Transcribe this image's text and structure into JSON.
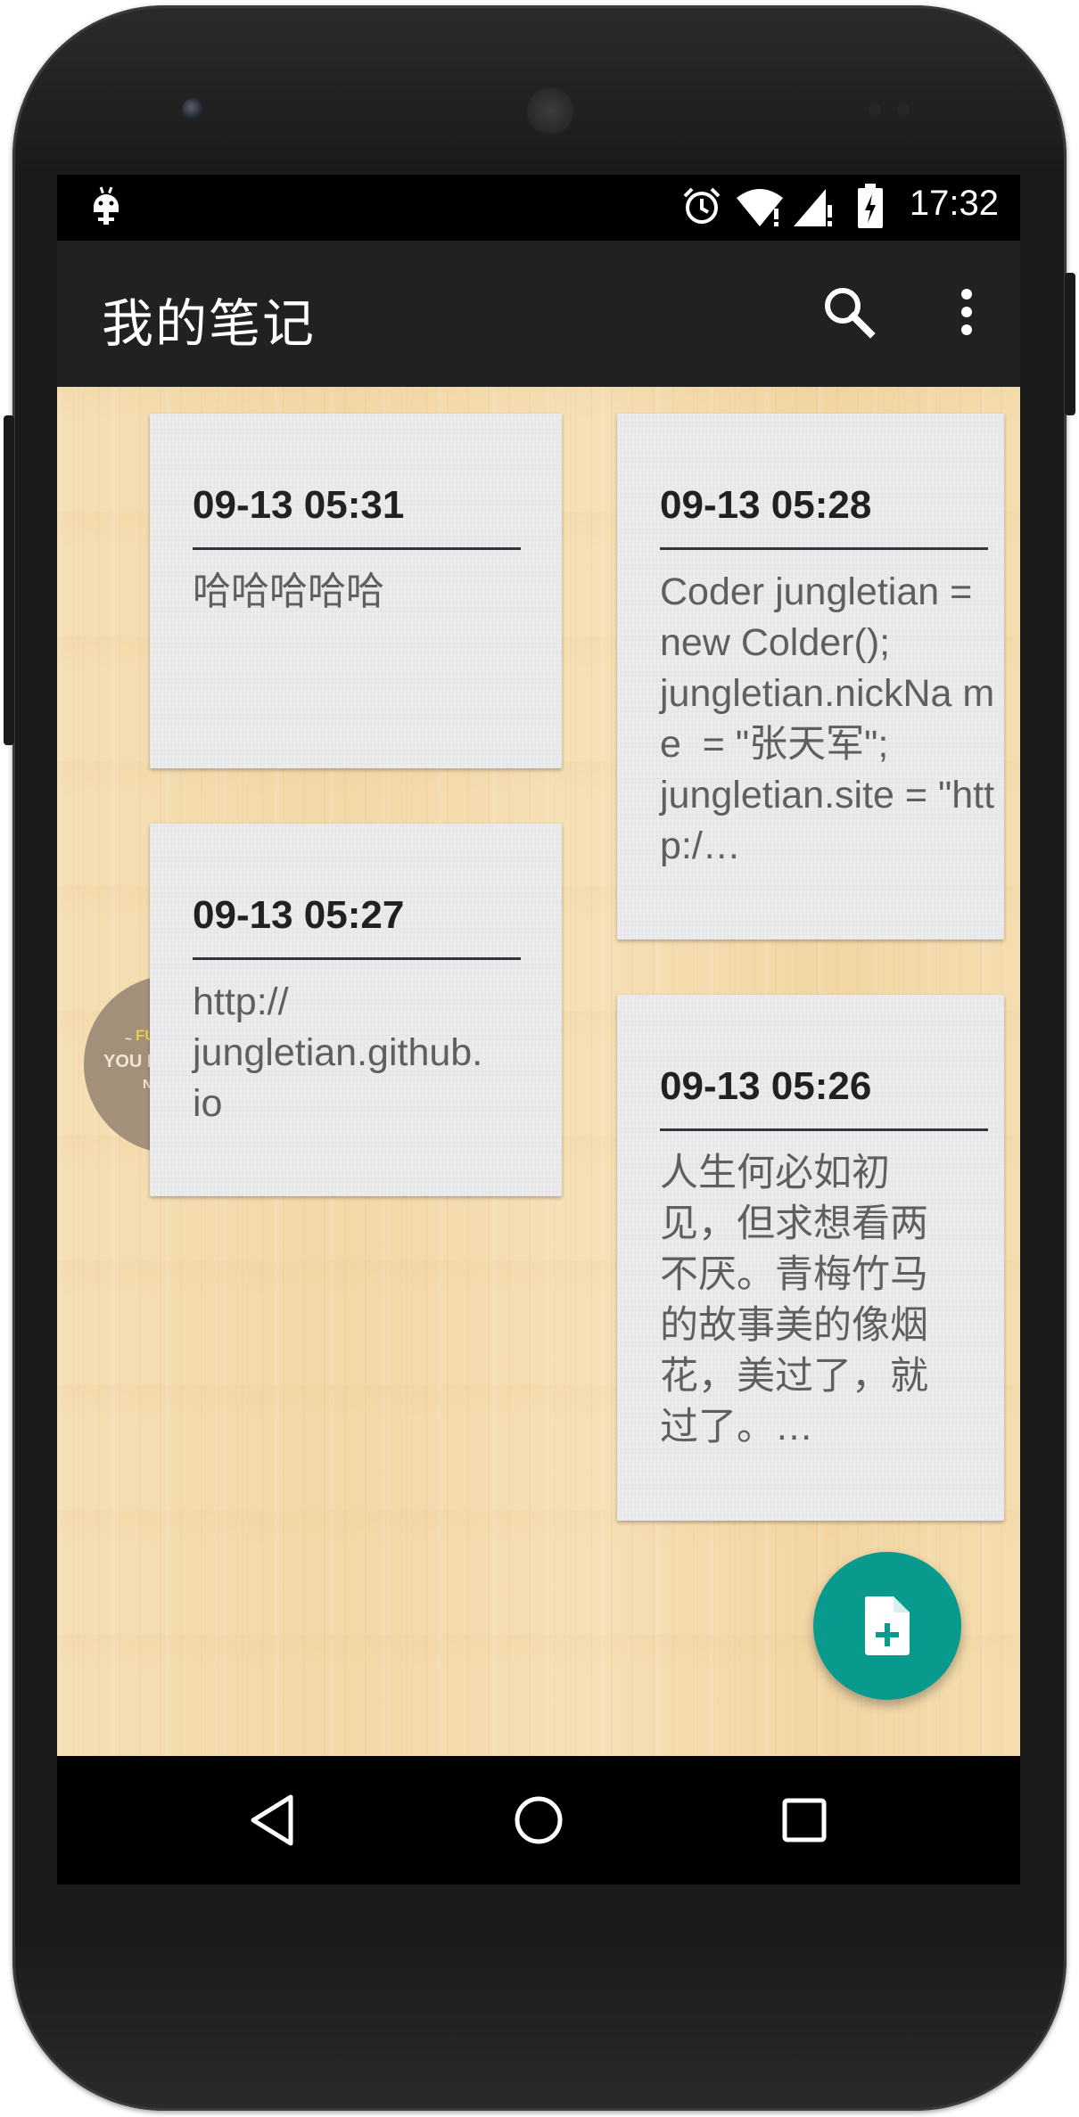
{
  "status_bar": {
    "time": "17:32",
    "icons": [
      "android-debug-icon",
      "alarm-icon",
      "wifi-icon",
      "signal-icon",
      "battery-charging-icon"
    ]
  },
  "app_bar": {
    "title": "我的笔记",
    "actions": [
      "search-icon",
      "more-vert-icon"
    ]
  },
  "notes": [
    {
      "date": "09-13 05:31",
      "body": "哈哈哈哈哈"
    },
    {
      "date": "09-13 05:28",
      "body": "Coder jungletian = new Colder();\njungletian.nickNa me  = \"张天军\";\njungletian.site = \"http:/…"
    },
    {
      "date": "09-13 05:27",
      "body": "http://\njungletian.github.\nio"
    },
    {
      "date": "09-13 05:26",
      "body": "人生何必如初见，但求想看两不厌。青梅竹马的故事美的像烟花，美过了，就过了。…"
    }
  ],
  "fab": {
    "icon": "note-add-icon"
  },
  "nav_bar": {
    "buttons": [
      "back-icon",
      "home-icon",
      "recents-icon"
    ]
  },
  "colors": {
    "app_bar": "#212121",
    "fab": "#079a8d",
    "note_bg": "#ebebed",
    "wood_bg": "#f4dcae"
  }
}
